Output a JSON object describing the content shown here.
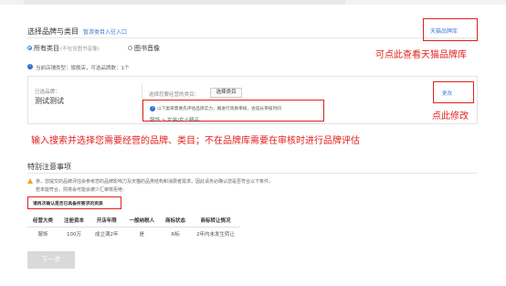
{
  "section": {
    "title": "选择品牌与类目",
    "link": "暂游类目入驻入口"
  },
  "catalog_button": {
    "label": "天猫品牌库"
  },
  "annotations": {
    "catalog_hint": "可点此查看天猫品牌库",
    "modify_hint": "点此修改",
    "search_hint": "输入搜索并选择您需要经营的品牌、类目；不在品牌库需要在审核时进行品牌评估"
  },
  "category_mode": {
    "options": [
      {
        "label": "所有类目",
        "sub": "(不包含图书音像)",
        "selected": true
      },
      {
        "label": "图书音像",
        "sub": "",
        "selected": false
      }
    ]
  },
  "store_type_info": "当前店铺类型：旗舰店，可选品牌数：1个",
  "brand_card": {
    "brand_label": "已选品牌：",
    "brand_name": "测试测试",
    "category_label": "选择您要经营的类目：",
    "select_button": "选择类目",
    "warning": "以下类目需要先评估品牌实力，再进行资质审核，会延长审核时间",
    "category_path": "服饰 > 女装/女士精品",
    "edit_link": "更改"
  },
  "notice": {
    "title": "特别注意事项",
    "line1": "亲，您提交的品牌评估会参考您的品牌影响力及天猫的品类结构和消费者需求，因此请务必确认您是否符合以下条件，",
    "line2": "若未能符合，则将会可能会被少汇审核拒绝：",
    "box_text": "请再次确认是否已具备所要求的资质"
  },
  "table": {
    "headers": [
      "经营大类",
      "注册资本",
      "开店年限",
      "一般纳税人",
      "商标状态",
      "商标转让情况"
    ],
    "rows": [
      [
        "服饰",
        "100万",
        "成立满2年",
        "是",
        "R标",
        "2年内未发生转让"
      ]
    ]
  },
  "next_button": "下一步",
  "colors": {
    "accent": "#3c7fd6",
    "annotation": "#e0211d"
  }
}
